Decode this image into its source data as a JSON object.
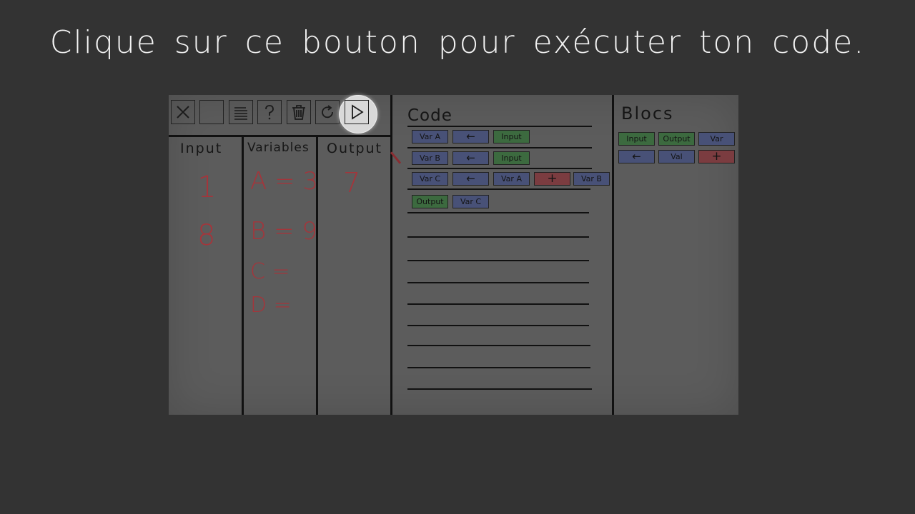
{
  "tutorial": {
    "message": "Clique sur ce bouton pour exécuter ton code."
  },
  "toolbar": {
    "buttons": [
      {
        "icon": "close-icon"
      },
      {
        "icon": "blank"
      },
      {
        "icon": "list-icon"
      },
      {
        "icon": "help-icon"
      },
      {
        "icon": "trash-icon"
      },
      {
        "icon": "reset-icon"
      },
      {
        "icon": "play-icon"
      }
    ]
  },
  "columns": {
    "input": {
      "title": "Input",
      "values": [
        "1",
        "8"
      ]
    },
    "variables": {
      "title": "Variables",
      "values": [
        "A = 3",
        "B = 9",
        "C =",
        "D ="
      ]
    },
    "output": {
      "title": "Output",
      "values": [
        "7"
      ]
    }
  },
  "code": {
    "title": "Code",
    "lines": [
      [
        {
          "label": "Var A",
          "color": "blue"
        },
        {
          "label": "←",
          "color": "blue"
        },
        {
          "label": "Input",
          "color": "green"
        }
      ],
      [
        {
          "label": "Var B",
          "color": "blue"
        },
        {
          "label": "←",
          "color": "blue"
        },
        {
          "label": "Input",
          "color": "green"
        }
      ],
      [
        {
          "label": "Var C",
          "color": "blue"
        },
        {
          "label": "←",
          "color": "blue"
        },
        {
          "label": "Var A",
          "color": "blue"
        },
        {
          "label": "+",
          "color": "red"
        },
        {
          "label": "Var B",
          "color": "blue"
        }
      ],
      [
        {
          "label": "Output",
          "color": "green"
        },
        {
          "label": "Var C",
          "color": "blue"
        }
      ]
    ]
  },
  "blocs": {
    "title": "Blocs",
    "items": [
      {
        "label": "Input",
        "color": "green"
      },
      {
        "label": "Output",
        "color": "green"
      },
      {
        "label": "Var",
        "color": "blue"
      },
      {
        "label": "←",
        "color": "blue"
      },
      {
        "label": "Val",
        "color": "blue"
      },
      {
        "label": "+",
        "color": "red"
      }
    ]
  },
  "colors": {
    "green": "#3c6a3f",
    "blue": "#485177",
    "red": "#7b3c40",
    "ink": "#a4353b",
    "background": "#333333",
    "board": "#5c5c5c"
  }
}
